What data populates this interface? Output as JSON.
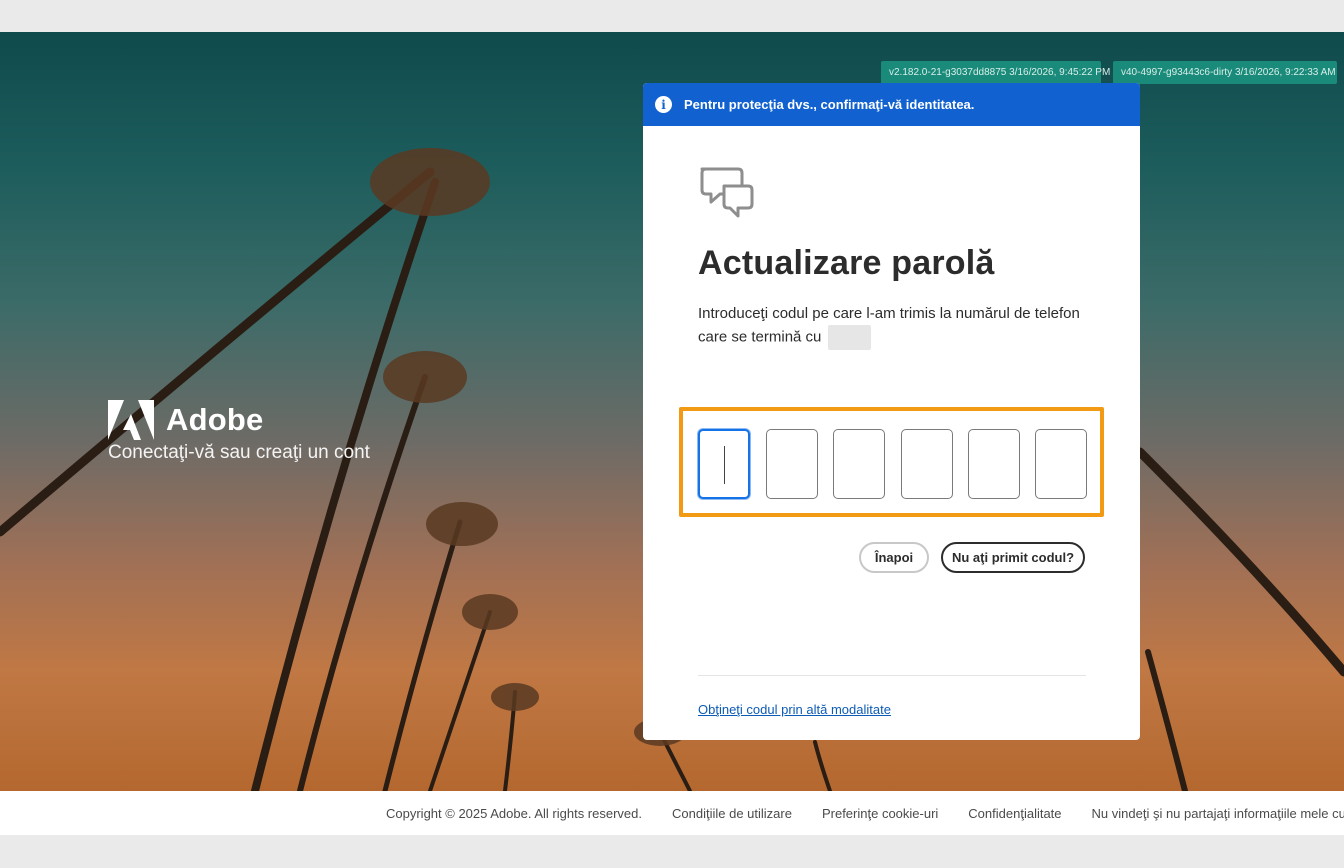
{
  "versions": {
    "badge1": "v2.182.0-21-g3037dd8875 3/16/2026, 9:45:22 PM",
    "badge2": "v40-4997-g93443c6-dirty 3/16/2026, 9:22:33 AM"
  },
  "brand": {
    "name": "Adobe",
    "tagline": "Conectaţi-vă sau creaţi un cont",
    "logo_icon": "adobe-logo-icon"
  },
  "card": {
    "banner_text": "Pentru protecţia dvs., confirmaţi-vă identitatea.",
    "banner_icon": "info-icon",
    "header_icon": "chat-bubbles-icon",
    "title": "Actualizare parolă",
    "description": "Introduceţi codul pe care l-am trimis la numărul de telefon care se termină cu",
    "otp": {
      "digits": [
        "",
        "",
        "",
        "",
        "",
        ""
      ],
      "active_index": 0
    },
    "back_button": "Înapoi",
    "resend_button": "Nu aţi primit codul?",
    "alt_link": "Obţineţi codul prin altă modalitate"
  },
  "footer": {
    "copyright": "Copyright © 2025 Adobe. All rights reserved.",
    "links": [
      "Condiţiile de utilizare",
      "Preferinţe cookie-uri",
      "Confidenţialitate",
      "Nu vindeţi şi nu partajaţi informaţiile mele cu ca"
    ]
  },
  "colors": {
    "banner_blue": "#1162d0",
    "highlight_orange": "#f29a13",
    "badge_teal": "#1a8a7a",
    "link_blue": "#0d5bb5"
  }
}
